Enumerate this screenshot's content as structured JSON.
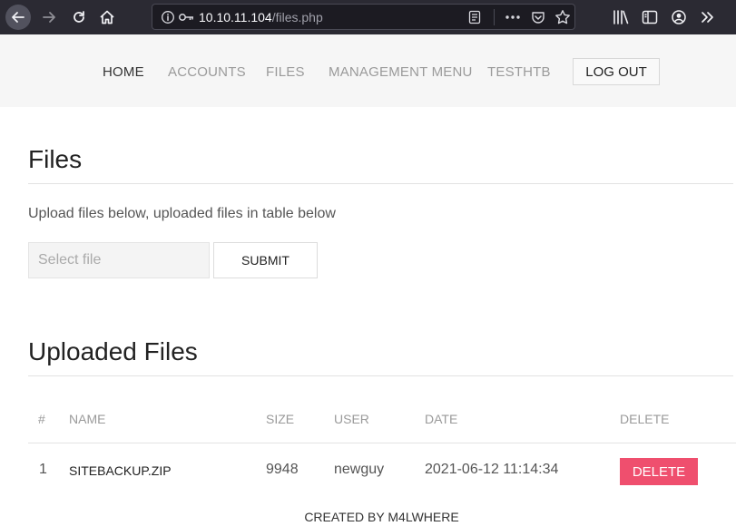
{
  "browser": {
    "url_host": "10.10.11.104",
    "url_path": "/files.php",
    "icons": [
      "back-icon",
      "forward-icon",
      "reload-icon",
      "home-icon",
      "info-icon",
      "key-icon",
      "reader-icon",
      "more-icon",
      "pocket-icon",
      "star-icon",
      "library-icon",
      "sidebar-icon",
      "account-icon",
      "overflow-icon"
    ],
    "chrome_color": "#2b2a33"
  },
  "nav": {
    "items": [
      {
        "label": "HOME"
      },
      {
        "label": "ACCOUNTS"
      },
      {
        "label": "FILES"
      },
      {
        "label": "MANAGEMENT MENU"
      },
      {
        "label": "TESTHTB"
      }
    ],
    "logout_label": "LOG OUT"
  },
  "files_section": {
    "title": "Files",
    "upload_text": "Upload files below, uploaded files in table below",
    "file_placeholder": "Select file",
    "submit_label": "SUBMIT"
  },
  "uploaded_section": {
    "title": "Uploaded Files",
    "columns": [
      "#",
      "NAME",
      "SIZE",
      "USER",
      "DATE",
      "DELETE"
    ],
    "rows": [
      {
        "num": "1",
        "name": "SITEBACKUP.ZIP",
        "size": "9948",
        "user": "newguy",
        "date": "2021-06-12 11:14:34",
        "delete_label": "DELETE"
      }
    ]
  },
  "footer": {
    "text": "CREATED BY M4LWHERE"
  },
  "colors": {
    "delete_button": "#ef4f6e",
    "nav_bg": "#f6f6f6"
  }
}
